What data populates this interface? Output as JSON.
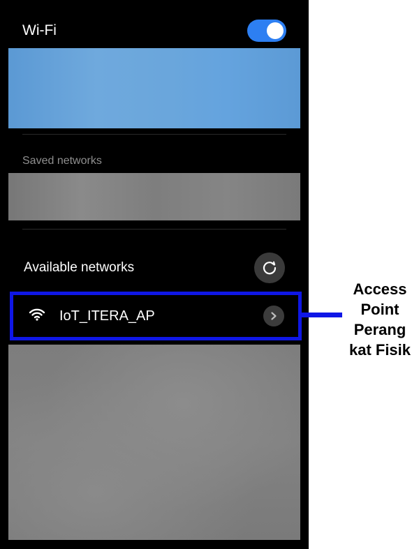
{
  "wifi": {
    "title": "Wi-Fi",
    "toggle_on": true,
    "accent_color": "#2d7ff2"
  },
  "saved": {
    "title": "Saved networks"
  },
  "available": {
    "title": "Available networks",
    "refresh_icon": "refresh-icon",
    "networks": [
      {
        "name": "IoT_ITERA_AP",
        "icon": "wifi-icon",
        "action_icon": "chevron-right-icon"
      }
    ]
  },
  "annotation": {
    "lines": [
      "Access",
      "Point",
      "Perang",
      "kat Fisik"
    ],
    "highlight_color": "#0f17e6"
  }
}
